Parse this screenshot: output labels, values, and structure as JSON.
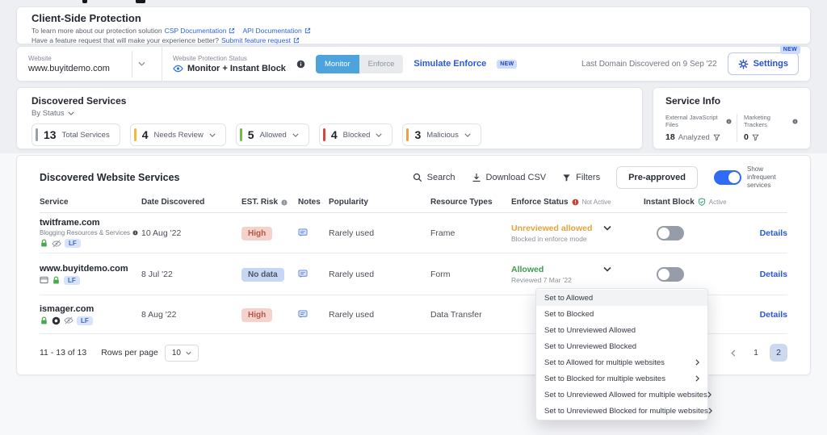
{
  "colors": {
    "accent_blue": "#2b50c8",
    "link_blue": "#2e63e0",
    "monitor_active_blue": "#4da3dc",
    "toggle_on_blue": "#2f6bf6",
    "risk_high_bg": "#f5d2cb",
    "risk_high_text": "#b4574a",
    "risk_nodata_bg": "#c7d7f3",
    "unreviewed_allowed_orange": "#e6a23c",
    "allowed_green": "#3f9a4e",
    "not_active_red": "#d63b2f",
    "active_green": "#2ba06a"
  },
  "header": {
    "title": "Client-Side Protection",
    "intro_prefix": "To learn more about our protection solution",
    "csp_doc_link": "CSP Documentation",
    "api_doc_link": "API Documentation",
    "feature_prefix": "Have a feature request that will make your experience better?",
    "feature_link": "Submit feature request"
  },
  "website_bar": {
    "website_label": "Website",
    "website_value": "www.buyitdemo.com",
    "status_label": "Website Protection Status",
    "status_value": "Monitor + Instant Block",
    "monitor_button": "Monitor",
    "enforce_button": "Enforce",
    "simulate_link": "Simulate Enforce",
    "new_badge": "NEW",
    "last_domain_text": "Last Domain Discovered on 9 Sep '22",
    "settings_button": "Settings",
    "settings_new_badge": "NEW"
  },
  "discovered_services": {
    "title": "Discovered Services",
    "by_status_label": "By Status",
    "stats": [
      {
        "count": "13",
        "label": "Total Services",
        "color": "#98a0a9"
      },
      {
        "count": "4",
        "label": "Needs Review",
        "color": "#f1b93c"
      },
      {
        "count": "5",
        "label": "Allowed",
        "color": "#6fbf44"
      },
      {
        "count": "4",
        "label": "Blocked",
        "color": "#d24a3c"
      },
      {
        "count": "3",
        "label": "Malicious",
        "color": "#f0a03c"
      }
    ]
  },
  "service_info": {
    "title": "Service Info",
    "js_label": "External JavaScript Files",
    "js_count": "18",
    "js_suffix": "Analyzed",
    "trackers_label": "Marketing Trackers",
    "trackers_count": "0"
  },
  "table": {
    "title": "Discovered Website Services",
    "toolbar": {
      "search_label": "Search",
      "download_label": "Download CSV",
      "filters_label": "Filters",
      "preapproved_label": "Pre-approved",
      "infrequent_toggle_label": "Show infrequent services"
    },
    "columns": {
      "service": "Service",
      "date": "Date Discovered",
      "risk": "EST. Risk",
      "notes": "Notes",
      "popularity": "Popularity",
      "resource": "Resource Types",
      "enforce": "Enforce Status",
      "enforce_state": "Not Active",
      "instant": "Instant Block",
      "instant_state": "Active"
    },
    "rows": [
      {
        "service": "twitframe.com",
        "category": "Blogging Resources & Services",
        "tag": "LF",
        "date": "10 Aug '22",
        "risk": "High",
        "popularity": "Rarely used",
        "resource": "Frame",
        "status": "Unreviewed allowed",
        "status_detail": "Blocked in enforce mode",
        "details_link": "Details"
      },
      {
        "service": "www.buyitdemo.com",
        "tag": "LF",
        "date": "8 Jul '22",
        "risk": "No data",
        "popularity": "Rarely used",
        "resource": "Form",
        "status": "Allowed",
        "status_detail": "Reviewed 7 Mar '22",
        "details_link": "Details"
      },
      {
        "service": "ismager.com",
        "tag": "LF",
        "date": "8 Aug '22",
        "risk": "High",
        "popularity": "Rarely used",
        "resource": "Data Transfer",
        "details_link": "Details"
      }
    ],
    "pagination": {
      "range_text": "11 - 13 of 13",
      "rows_per_page_label": "Rows per page",
      "rows_per_page_value": "10",
      "page1": "1",
      "page2": "2"
    }
  },
  "context_menu": {
    "items": [
      {
        "label": "Set to Allowed"
      },
      {
        "label": "Set to Blocked"
      },
      {
        "label": "Set to Unreviewed Allowed"
      },
      {
        "label": "Set to Unreviewed Blocked"
      },
      {
        "label": "Set to Allowed for multiple websites"
      },
      {
        "label": "Set to Blocked for multiple websites"
      },
      {
        "label": "Set to Unreviewed Allowed for multiple websites"
      },
      {
        "label": "Set to Unreviewed Blocked for multiple websites"
      }
    ]
  }
}
